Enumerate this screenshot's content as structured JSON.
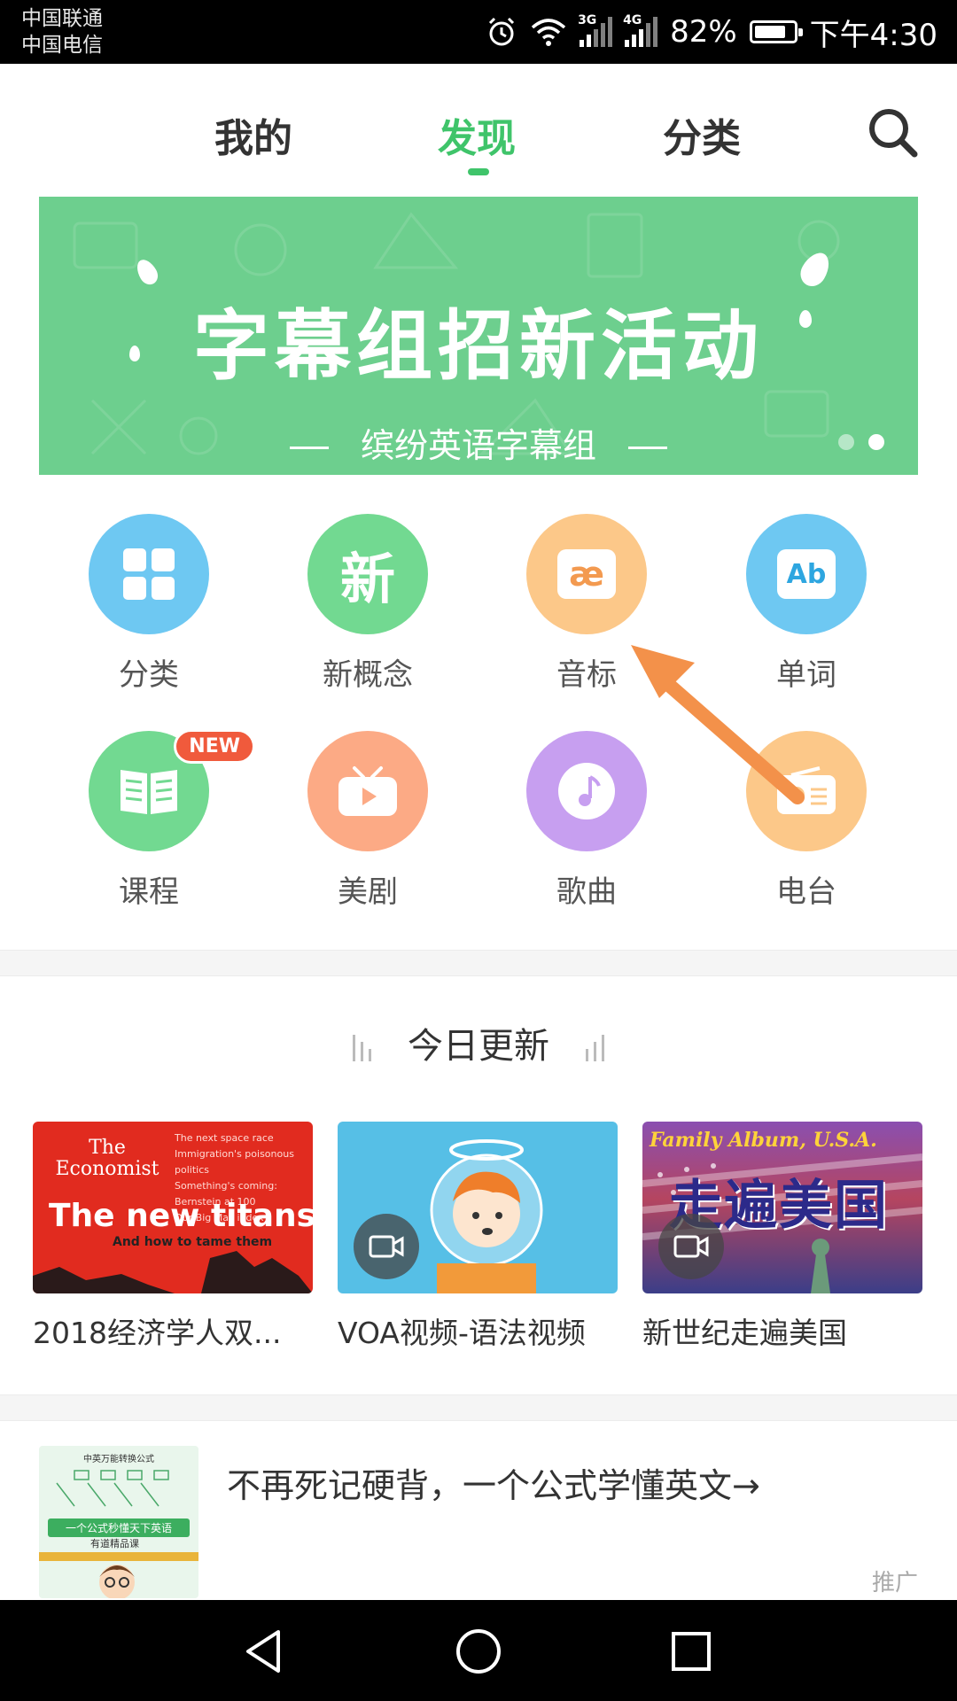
{
  "status": {
    "carrier1": "中国联通",
    "carrier2": "中国电信",
    "sig1_tag": "3G",
    "sig2_tag": "4G",
    "battery_text": "82%",
    "battery_level": 0.82,
    "time": "下午4:30"
  },
  "nav": {
    "tabs": [
      {
        "label": "我的"
      },
      {
        "label": "发现",
        "active": true
      },
      {
        "label": "分类"
      }
    ],
    "search_icon": "search-icon",
    "active_color": "#3fc46a"
  },
  "banner": {
    "title": "字幕组招新活动",
    "subtitle": "缤纷英语字幕组",
    "background": "#6dcf8e",
    "page_count": 2,
    "active_page": 2
  },
  "grid": [
    {
      "label": "分类",
      "icon": "grid-icon",
      "color": "#6ec8f2"
    },
    {
      "label": "新概念",
      "icon": "xin-icon",
      "icon_text": "新",
      "color": "#72d991"
    },
    {
      "label": "音标",
      "icon": "phonetic-icon",
      "icon_text": "æ",
      "color": "#fcc889"
    },
    {
      "label": "单词",
      "icon": "word-icon",
      "icon_text": "Ab",
      "color": "#6ec8f2"
    },
    {
      "label": "课程",
      "icon": "book-icon",
      "color": "#72d991",
      "badge": "NEW"
    },
    {
      "label": "美剧",
      "icon": "tv-icon",
      "color": "#fcaa85"
    },
    {
      "label": "歌曲",
      "icon": "music-icon",
      "color": "#c79ff0"
    },
    {
      "label": "电台",
      "icon": "radio-icon",
      "color": "#fcc889"
    }
  ],
  "today": {
    "title": "今日更新",
    "items": [
      {
        "title": "2018经济学人双...",
        "thumb": {
          "brand": "The Economist",
          "headline": "The new titans",
          "subhead": "And how to tame them",
          "lines": [
            "The next space race",
            "Immigration's poisonous politics",
            "Something's coming: Bernstein at 100",
            "Our Big Mac index"
          ]
        }
      },
      {
        "title": "VOA视频-语法视频",
        "thumb": {
          "icon": "video-icon"
        }
      },
      {
        "title": "新世纪走遍美国",
        "thumb": {
          "top_text": "Family Album, U.S.A.",
          "main_text": "走遍美国",
          "icon": "video-icon"
        }
      }
    ]
  },
  "ad": {
    "text": "不再死记硬背，一个公式学懂英文→",
    "tag": "推广",
    "thumb": {
      "caption": "一个公式秒懂天下英语",
      "brand": "有道精品课",
      "header": "中英万能转换公式"
    }
  }
}
